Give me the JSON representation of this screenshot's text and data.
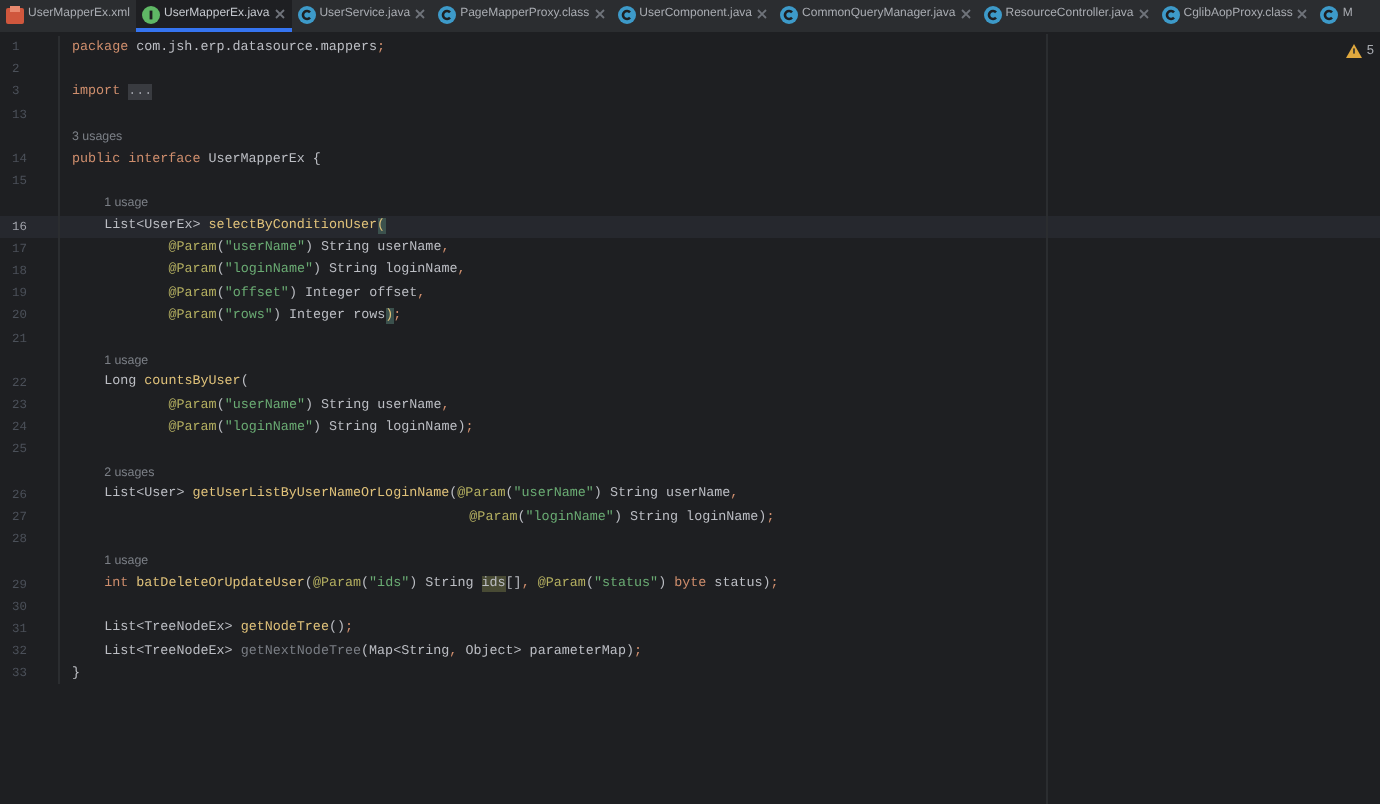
{
  "tabs": [
    {
      "label": "UserMapperEx.xml",
      "kind": "xml",
      "selected": false,
      "closable": false
    },
    {
      "label": "UserMapperEx.java",
      "kind": "interface",
      "selected": true,
      "closable": true
    },
    {
      "label": "UserService.java",
      "kind": "class",
      "selected": false,
      "closable": true
    },
    {
      "label": "PageMapperProxy.class",
      "kind": "class",
      "selected": false,
      "closable": true
    },
    {
      "label": "UserComponent.java",
      "kind": "class",
      "selected": false,
      "closable": true
    },
    {
      "label": "CommonQueryManager.java",
      "kind": "class",
      "selected": false,
      "closable": true
    },
    {
      "label": "ResourceController.java",
      "kind": "class",
      "selected": false,
      "closable": true
    },
    {
      "label": "CglibAopProxy.class",
      "kind": "class",
      "selected": false,
      "closable": true
    },
    {
      "label": "M",
      "kind": "class",
      "selected": false,
      "closable": false
    }
  ],
  "warnings": {
    "count": "5"
  },
  "lines": [
    {
      "kind": "code",
      "number": "1",
      "selected": false,
      "tokens": [
        {
          "kind": "keyword",
          "text": "package"
        },
        {
          "kind": "plain",
          "text": " com.jsh.erp.datasource.mappers"
        },
        {
          "kind": "punct",
          "text": ";"
        }
      ]
    },
    {
      "kind": "code",
      "number": "2",
      "selected": false
    },
    {
      "kind": "code",
      "number": "3",
      "selected": false,
      "tokens": [
        {
          "kind": "keyword",
          "text": "import"
        },
        {
          "kind": "fold",
          "text": "..."
        }
      ]
    },
    {
      "kind": "code",
      "number": "13",
      "selected": false
    },
    {
      "kind": "hint",
      "text": "3 usages"
    },
    {
      "kind": "code",
      "number": "14",
      "selected": false,
      "tokens": [
        {
          "kind": "keyword",
          "text": "public interface"
        },
        {
          "kind": "plain",
          "text": " UserMapperEx {"
        }
      ],
      "children": [
        {
          "kind": "code",
          "number": "15",
          "selected": false
        },
        {
          "kind": "hint",
          "text": "1 usage"
        },
        {
          "kind": "code",
          "number": "16",
          "selected": true,
          "tokens": [
            {
              "kind": "plain",
              "text": "List<UserEx> "
            },
            {
              "kind": "method",
              "text": "selectByConditionUser"
            },
            {
              "kind": "match",
              "text": "("
            }
          ],
          "children": [
            {
              "kind": "code",
              "number": "17",
              "selected": false,
              "tokens": [
                {
                  "kind": "annotation",
                  "text": "@Param"
                },
                {
                  "kind": "plain",
                  "text": "("
                },
                {
                  "kind": "string",
                  "text": "\"userName\""
                },
                {
                  "kind": "plain",
                  "text": ") String userName"
                },
                {
                  "kind": "punct",
                  "text": ","
                }
              ]
            },
            {
              "kind": "code",
              "number": "18",
              "selected": false,
              "tokens": [
                {
                  "kind": "annotation",
                  "text": "@Param"
                },
                {
                  "kind": "plain",
                  "text": "("
                },
                {
                  "kind": "string",
                  "text": "\"loginName\""
                },
                {
                  "kind": "plain",
                  "text": ") String loginName"
                },
                {
                  "kind": "punct",
                  "text": ","
                }
              ]
            },
            {
              "kind": "code",
              "number": "19",
              "selected": false,
              "tokens": [
                {
                  "kind": "annotation",
                  "text": "@Param"
                },
                {
                  "kind": "plain",
                  "text": "("
                },
                {
                  "kind": "string",
                  "text": "\"offset\""
                },
                {
                  "kind": "plain",
                  "text": ") Integer offset"
                },
                {
                  "kind": "punct",
                  "text": ","
                }
              ]
            },
            {
              "kind": "code",
              "number": "20",
              "selected": false,
              "tokens": [
                {
                  "kind": "annotation",
                  "text": "@Param"
                },
                {
                  "kind": "plain",
                  "text": "("
                },
                {
                  "kind": "string",
                  "text": "\"rows\""
                },
                {
                  "kind": "plain",
                  "text": ") Integer rows"
                },
                {
                  "kind": "match",
                  "text": ")"
                },
                {
                  "kind": "punct",
                  "text": ";"
                }
              ]
            }
          ]
        },
        {
          "kind": "code",
          "number": "21",
          "selected": false
        },
        {
          "kind": "hint",
          "text": "1 usage"
        },
        {
          "kind": "code",
          "number": "22",
          "selected": false,
          "tokens": [
            {
              "kind": "plain",
              "text": "Long "
            },
            {
              "kind": "method",
              "text": "countsByUser"
            },
            {
              "kind": "plain",
              "text": "("
            }
          ],
          "children": [
            {
              "kind": "code",
              "number": "23",
              "selected": false,
              "tokens": [
                {
                  "kind": "annotation",
                  "text": "@Param"
                },
                {
                  "kind": "plain",
                  "text": "("
                },
                {
                  "kind": "string",
                  "text": "\"userName\""
                },
                {
                  "kind": "plain",
                  "text": ") String userName"
                },
                {
                  "kind": "punct",
                  "text": ","
                }
              ]
            },
            {
              "kind": "code",
              "number": "24",
              "selected": false,
              "tokens": [
                {
                  "kind": "annotation",
                  "text": "@Param"
                },
                {
                  "kind": "plain",
                  "text": "("
                },
                {
                  "kind": "string",
                  "text": "\"loginName\""
                },
                {
                  "kind": "plain",
                  "text": ") String loginName)"
                },
                {
                  "kind": "punct",
                  "text": ";"
                }
              ]
            }
          ]
        },
        {
          "kind": "code",
          "number": "25",
          "selected": false
        },
        {
          "kind": "hint",
          "text": "2 usages"
        },
        {
          "kind": "code",
          "number": "26",
          "selected": false,
          "tokens": [
            {
              "kind": "plain",
              "text": "List<User> "
            },
            {
              "kind": "method",
              "text": "getUserListByUserNameOrLoginName"
            },
            {
              "kind": "plain",
              "text": "("
            },
            {
              "kind": "annotation",
              "text": "@Param"
            },
            {
              "kind": "plain",
              "text": "("
            },
            {
              "kind": "string",
              "text": "\"userName\""
            },
            {
              "kind": "plain",
              "text": ") String userName"
            },
            {
              "kind": "punct",
              "text": ","
            }
          ],
          "children": [
            {
              "kind": "aligned",
              "number": "27",
              "selected": false,
              "tokens": [
                {
                  "kind": "annotation",
                  "text": "@Param"
                },
                {
                  "kind": "plain",
                  "text": "("
                },
                {
                  "kind": "string",
                  "text": "\"loginName\""
                },
                {
                  "kind": "plain",
                  "text": ") String loginName)"
                },
                {
                  "kind": "punct",
                  "text": ";"
                }
              ]
            }
          ]
        },
        {
          "kind": "code",
          "number": "28",
          "selected": false
        },
        {
          "kind": "hint",
          "text": "1 usage"
        },
        {
          "kind": "code",
          "number": "29",
          "selected": false,
          "tokens": [
            {
              "kind": "keyword",
              "text": "int"
            },
            {
              "kind": "method",
              "text": " batDeleteOrUpdateUser"
            },
            {
              "kind": "plain",
              "text": "("
            },
            {
              "kind": "annotation",
              "text": "@Param"
            },
            {
              "kind": "plain",
              "text": "("
            },
            {
              "kind": "string",
              "text": "\"ids\""
            },
            {
              "kind": "plain",
              "text": ") String "
            },
            {
              "kind": "occurrence",
              "text": "ids"
            },
            {
              "kind": "plain",
              "text": "[]"
            },
            {
              "kind": "punct",
              "text": ", "
            },
            {
              "kind": "annotation",
              "text": "@Param"
            },
            {
              "kind": "plain",
              "text": "("
            },
            {
              "kind": "string",
              "text": "\"status\""
            },
            {
              "kind": "plain",
              "text": ") "
            },
            {
              "kind": "keyword",
              "text": "byte"
            },
            {
              "kind": "plain",
              "text": " status)"
            },
            {
              "kind": "punct",
              "text": ";"
            }
          ]
        },
        {
          "kind": "code",
          "number": "30",
          "selected": false
        },
        {
          "kind": "code",
          "number": "31",
          "selected": false,
          "tokens": [
            {
              "kind": "plain",
              "text": "List<TreeNodeEx> "
            },
            {
              "kind": "method",
              "text": "getNodeTree"
            },
            {
              "kind": "plain",
              "text": "()"
            },
            {
              "kind": "punct",
              "text": ";"
            }
          ]
        },
        {
          "kind": "code",
          "number": "32",
          "selected": false,
          "tokens": [
            {
              "kind": "plain",
              "text": "List<TreeNodeEx> "
            },
            {
              "kind": "unused",
              "text": "getNextNodeTree"
            },
            {
              "kind": "plain",
              "text": "(Map<String"
            },
            {
              "kind": "punct",
              "text": ","
            },
            {
              "kind": "plain",
              "text": " Object> parameterMap)"
            },
            {
              "kind": "punct",
              "text": ";"
            }
          ]
        }
      ]
    },
    {
      "kind": "code",
      "number": "33",
      "selected": false,
      "tokens": [
        {
          "kind": "plain",
          "text": "}"
        }
      ]
    }
  ]
}
